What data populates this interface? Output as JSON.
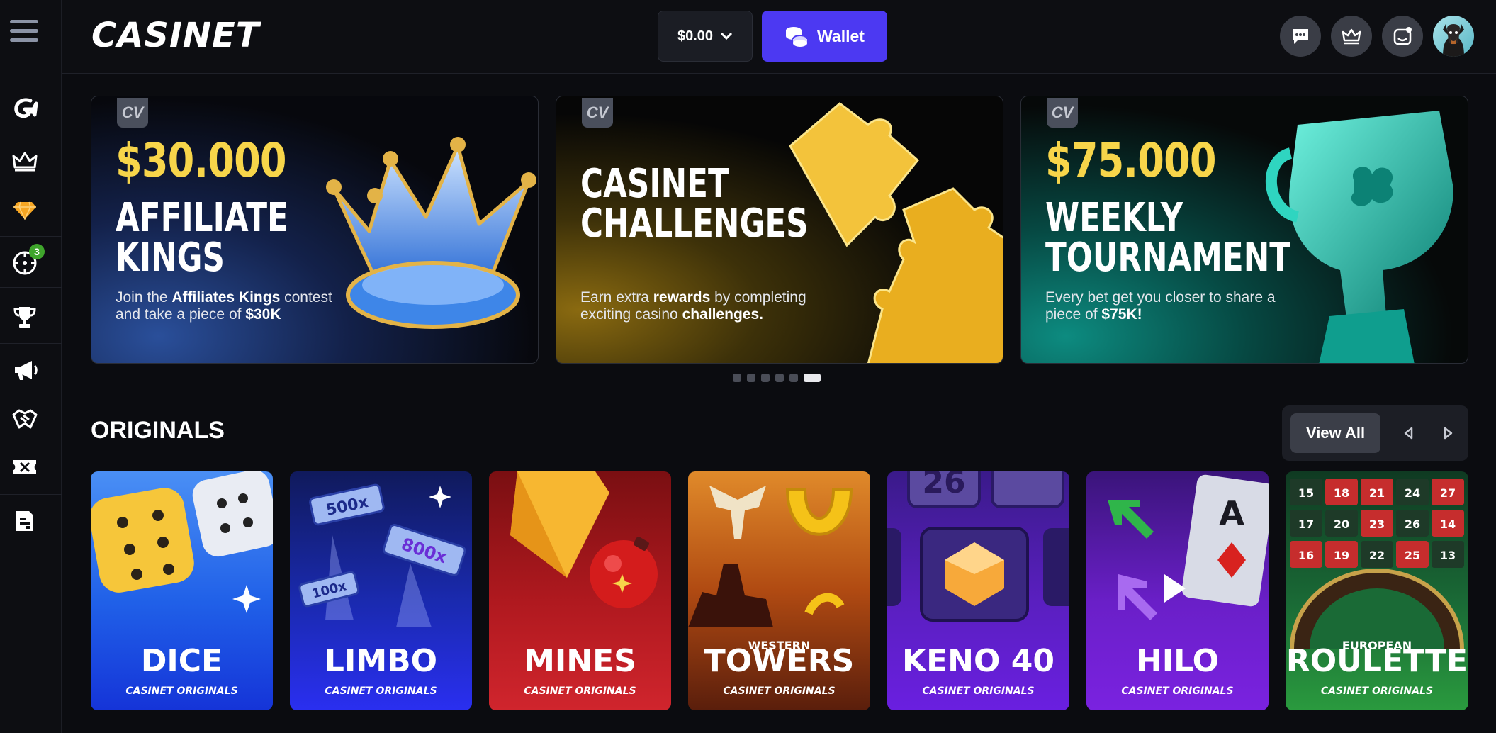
{
  "header": {
    "logo": "CASINET",
    "balance": "$0.00",
    "wallet_label": "Wallet"
  },
  "sidebar": {
    "items": [
      {
        "name": "casinet-logo-icon"
      },
      {
        "name": "crown-icon"
      },
      {
        "name": "diamond-icon"
      },
      {
        "name": "crosshair-icon",
        "badge": "3"
      },
      {
        "name": "trophy-icon"
      },
      {
        "name": "megaphone-icon"
      },
      {
        "name": "handshake-icon"
      },
      {
        "name": "ticket-icon"
      },
      {
        "name": "document-icon"
      }
    ]
  },
  "banners": [
    {
      "amount": "$30.000",
      "title_line1": "AFFILIATE",
      "title_line2": "KINGS",
      "desc_pre": "Join the ",
      "desc_bold": "Affiliates Kings",
      "desc_post": " contest and take a piece of ",
      "desc_bold2": "$30K"
    },
    {
      "title_line1": "CASINET",
      "title_line2": "CHALLENGES",
      "desc_pre": "Earn extra ",
      "desc_bold": "rewards",
      "desc_post": " by completing exciting casino ",
      "desc_bold2": "challenges."
    },
    {
      "amount": "$75.000",
      "title_line1": "WEEKLY",
      "title_line2": "TOURNAMENT",
      "desc_pre": "Every bet get you closer to share a piece of ",
      "desc_bold": "$75K!"
    }
  ],
  "carousel": {
    "count": 6,
    "active_index": 5
  },
  "originals": {
    "title": "ORIGINALS",
    "view_all": "View All",
    "subtitle": "CASINET ORIGINALS",
    "games": [
      {
        "name": "DICE",
        "pre": ""
      },
      {
        "name": "LIMBO",
        "pre": ""
      },
      {
        "name": "MINES",
        "pre": ""
      },
      {
        "name": "TOWERS",
        "pre": "WESTERN"
      },
      {
        "name": "KENO 40",
        "pre": ""
      },
      {
        "name": "HILO",
        "pre": ""
      },
      {
        "name": "ROULETTE",
        "pre": "EUROPEAN"
      }
    ],
    "art_labels": {
      "limbo": [
        "500x",
        "800x",
        "100x"
      ],
      "keno": [
        "26"
      ],
      "hilo_card": "A",
      "roulette": [
        "15",
        "18",
        "21",
        "24",
        "27",
        "17",
        "20",
        "23",
        "26",
        "14",
        "16",
        "19",
        "22",
        "25",
        "13"
      ]
    }
  },
  "colors": {
    "accent": "#4c39f2",
    "background": "#0b0c10",
    "badge": "#3fa52c"
  }
}
